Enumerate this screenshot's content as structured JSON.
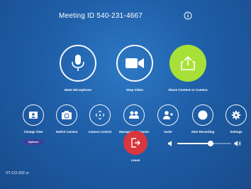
{
  "header": {
    "meeting_id": "Meeting ID 540-231-4667",
    "info_icon": "info-icon"
  },
  "main_actions": [
    {
      "label": "Mute Microphone",
      "icon": "microphone-icon"
    },
    {
      "label": "Stop Video",
      "icon": "video-camera-icon"
    },
    {
      "label": "Share Content or Camera",
      "icon": "share-icon"
    }
  ],
  "secondary_actions": [
    {
      "label": "Change View",
      "icon": "view-icon"
    },
    {
      "label": "Switch Camera",
      "icon": "switch-camera-icon"
    },
    {
      "label": "Camera Control",
      "icon": "camera-control-icon"
    },
    {
      "label": "Manage Participants",
      "icon": "participants-icon"
    },
    {
      "label": "Invite",
      "icon": "add-user-icon"
    },
    {
      "label": "Start Recording",
      "icon": "record-icon"
    },
    {
      "label": "Settings",
      "icon": "gear-icon"
    }
  ],
  "options_label": "Options",
  "leave": {
    "label": "Leave",
    "icon": "leave-icon"
  },
  "volume": {
    "level": 0.62,
    "low_icon": "volume-low-icon",
    "high_icon": "volume-high-icon"
  },
  "footer": {
    "room_name": "VT-CO-202 zr"
  },
  "colors": {
    "background": "#1f5ea8",
    "share_accent": "#a7e138",
    "leave_red": "#d9363e",
    "options_pill": "#3b3f9b"
  }
}
